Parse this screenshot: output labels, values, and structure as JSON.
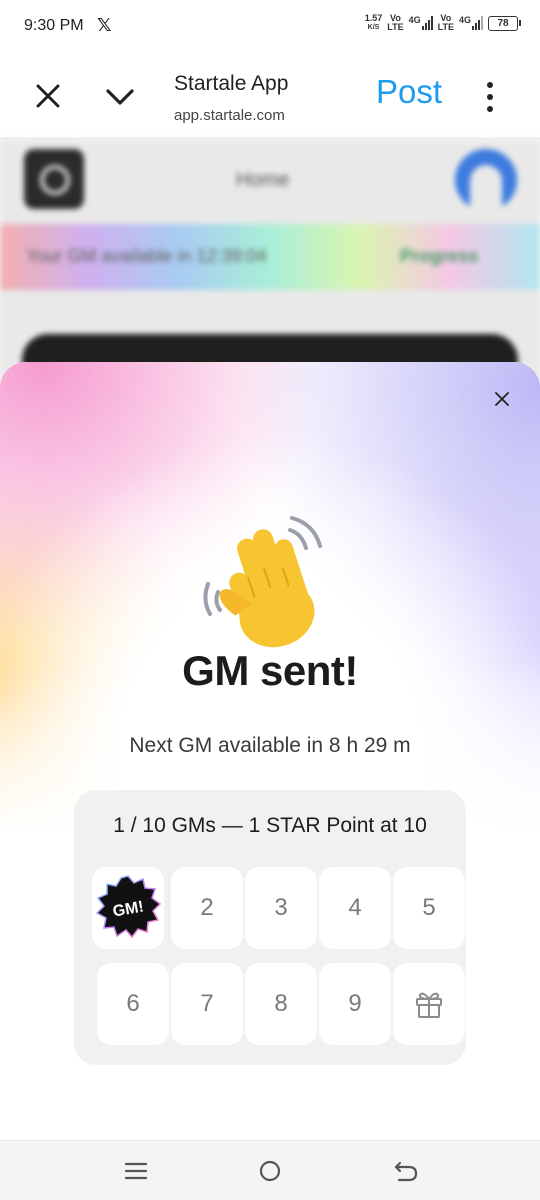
{
  "status_bar": {
    "time": "9:30 PM",
    "x_logo": "𝕏",
    "net_speed": "1.57",
    "net_speed_unit": "K/S",
    "sim1_top": "Vo",
    "sim1_bottom": "LTE",
    "sim1_net": "4G",
    "sim2_top": "Vo",
    "sim2_bottom": "LTE",
    "sim2_net": "4G",
    "battery": "78"
  },
  "header": {
    "title": "Startale App",
    "url": "app.startale.com",
    "post_label": "Post",
    "post_color": "#1d9bf0"
  },
  "background_page": {
    "nav_title": "Home",
    "banner_text": "Your GM available in 12:39:04",
    "banner_link": "Progress"
  },
  "modal": {
    "emoji": "👋",
    "title": "GM sent!",
    "subtitle": "Next GM available in 8 h 29 m",
    "progress": {
      "title": "1 / 10 GMs — 1 STAR Point at 10",
      "completed": 1,
      "total": 10,
      "badge_text": "GM!",
      "tiles": [
        "GM!",
        "2",
        "3",
        "4",
        "5",
        "6",
        "7",
        "8",
        "9",
        "gift-icon"
      ]
    }
  },
  "nav_bar": {
    "icons": [
      "menu-icon",
      "home-circle-icon",
      "back-icon"
    ]
  }
}
